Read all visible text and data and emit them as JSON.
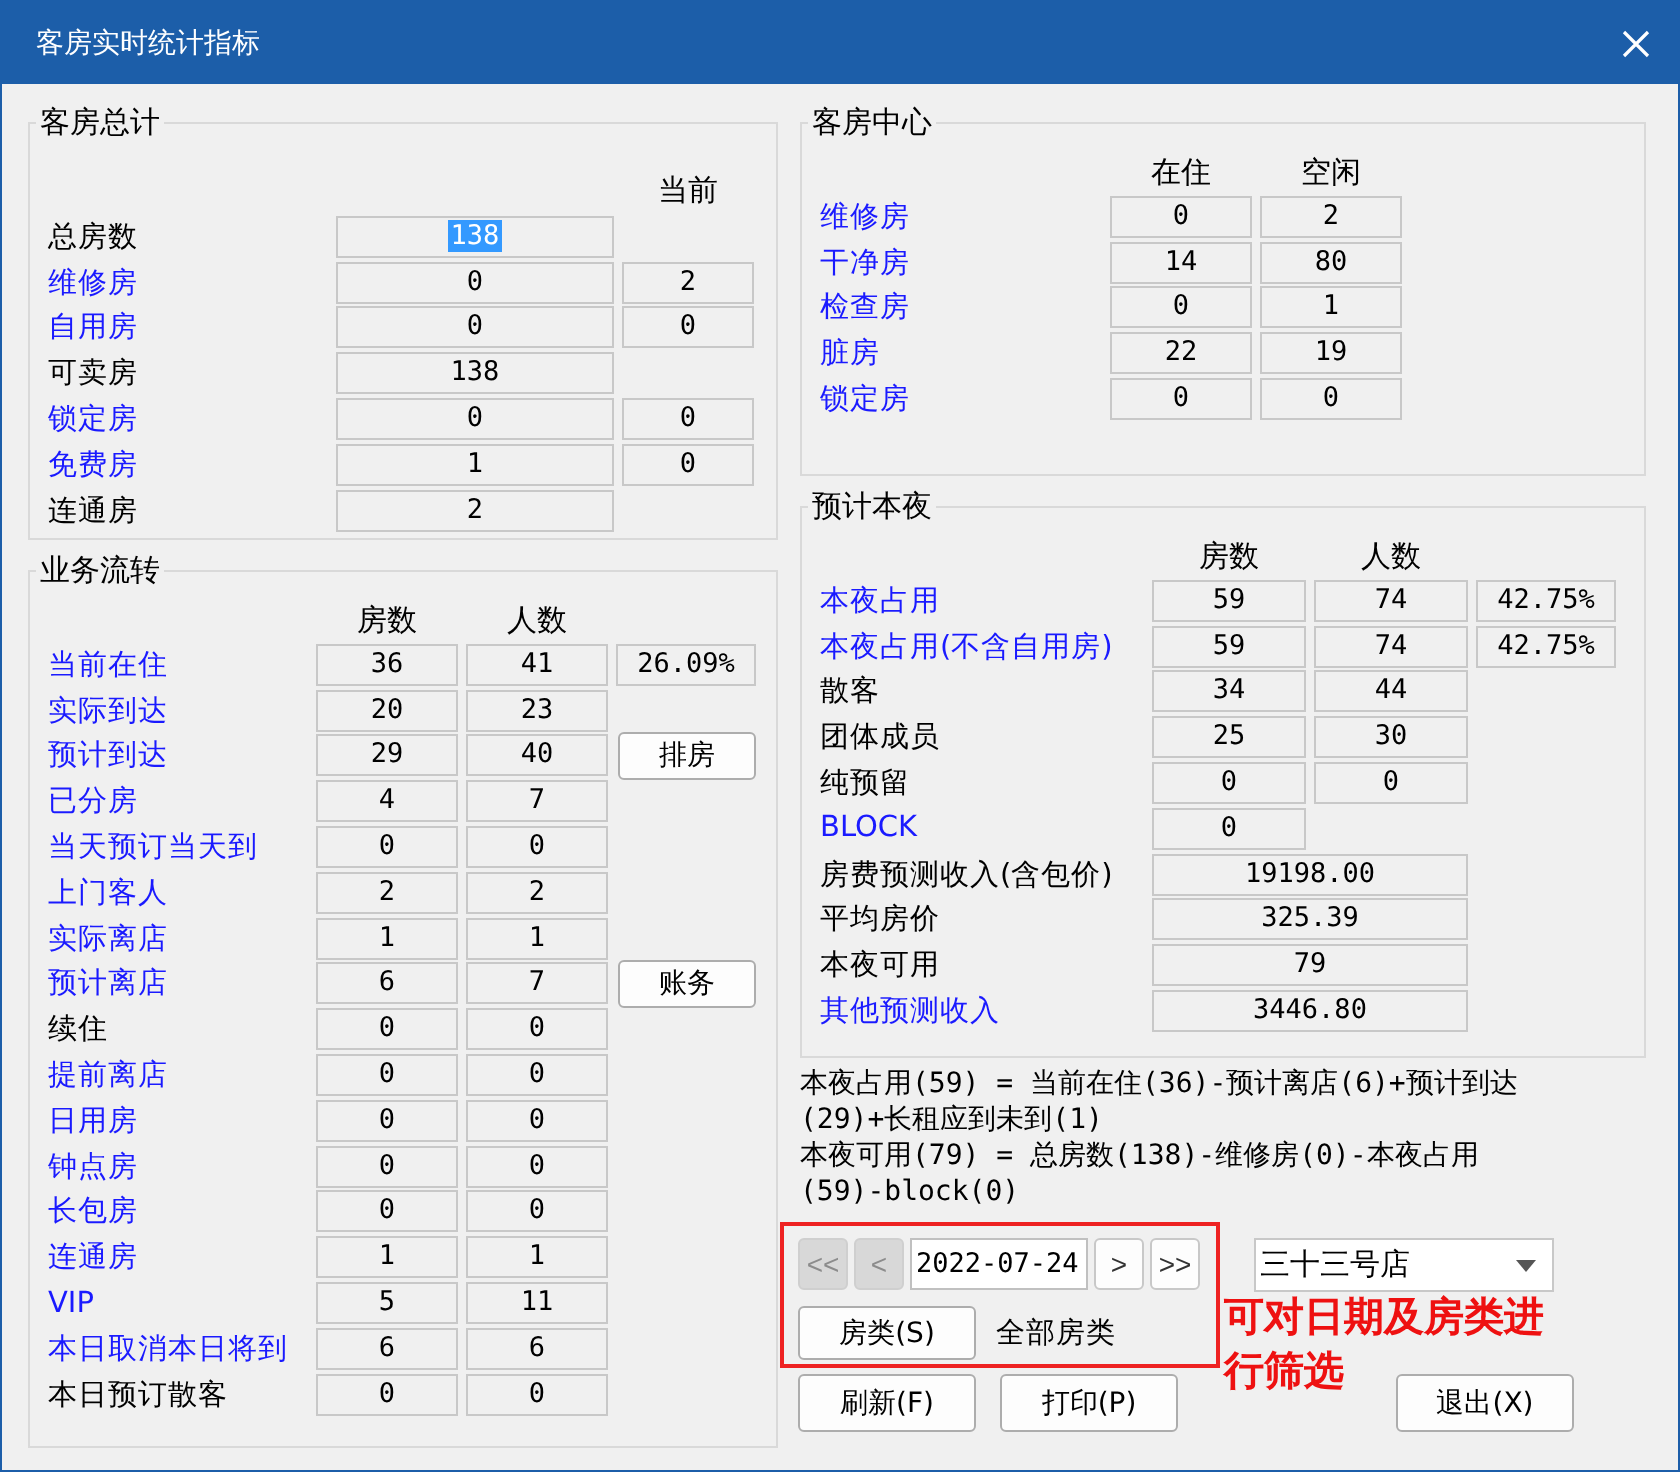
{
  "window": {
    "title": "客房实时统计指标"
  },
  "room_totals": {
    "title": "客房总计",
    "current_header": "当前",
    "rows": [
      {
        "label": "总房数",
        "link": false,
        "highlighted": true,
        "cells": [
          "138"
        ]
      },
      {
        "label": "维修房",
        "link": true,
        "highlighted": false,
        "cells": [
          "0",
          "2"
        ]
      },
      {
        "label": "自用房",
        "link": true,
        "highlighted": false,
        "cells": [
          "0",
          "0"
        ]
      },
      {
        "label": "可卖房",
        "link": false,
        "highlighted": false,
        "cells": [
          "138"
        ]
      },
      {
        "label": "锁定房",
        "link": true,
        "highlighted": false,
        "cells": [
          "0",
          "0"
        ]
      },
      {
        "label": "免费房",
        "link": true,
        "highlighted": false,
        "cells": [
          "1",
          "0"
        ]
      },
      {
        "label": "连通房",
        "link": false,
        "highlighted": false,
        "cells": [
          "2"
        ]
      }
    ]
  },
  "business_flow": {
    "title": "业务流转",
    "headers": [
      "房数",
      "人数"
    ],
    "rows": [
      {
        "label": "当前在住",
        "link": true,
        "cells": [
          "36",
          "41"
        ],
        "extra": {
          "kind": "value",
          "text": "26.09%"
        }
      },
      {
        "label": "实际到达",
        "link": true,
        "cells": [
          "20",
          "23"
        ]
      },
      {
        "label": "预计到达",
        "link": true,
        "cells": [
          "29",
          "40"
        ],
        "extra": {
          "kind": "button",
          "text": "排房"
        }
      },
      {
        "label": "已分房",
        "link": true,
        "cells": [
          "4",
          "7"
        ]
      },
      {
        "label": "当天预订当天到",
        "link": true,
        "cells": [
          "0",
          "0"
        ]
      },
      {
        "label": "上门客人",
        "link": true,
        "cells": [
          "2",
          "2"
        ]
      },
      {
        "label": "实际离店",
        "link": true,
        "cells": [
          "1",
          "1"
        ]
      },
      {
        "label": "预计离店",
        "link": true,
        "cells": [
          "6",
          "7"
        ],
        "extra": {
          "kind": "button",
          "text": "账务"
        }
      },
      {
        "label": "续住",
        "link": false,
        "cells": [
          "0",
          "0"
        ]
      },
      {
        "label": "提前离店",
        "link": true,
        "cells": [
          "0",
          "0"
        ]
      },
      {
        "label": "日用房",
        "link": true,
        "cells": [
          "0",
          "0"
        ]
      },
      {
        "label": "钟点房",
        "link": true,
        "cells": [
          "0",
          "0"
        ]
      },
      {
        "label": "长包房",
        "link": true,
        "cells": [
          "0",
          "0"
        ]
      },
      {
        "label": "连通房",
        "link": true,
        "cells": [
          "1",
          "1"
        ]
      },
      {
        "label": "VIP",
        "link": true,
        "cells": [
          "5",
          "11"
        ]
      },
      {
        "label": "本日取消本日将到",
        "link": true,
        "cells": [
          "6",
          "6"
        ]
      },
      {
        "label": "本日预订散客",
        "link": false,
        "cells": [
          "0",
          "0"
        ]
      }
    ]
  },
  "room_center": {
    "title": "客房中心",
    "headers": [
      "在住",
      "空闲"
    ],
    "rows": [
      {
        "label": "维修房",
        "link": true,
        "cells": [
          "0",
          "2"
        ]
      },
      {
        "label": "干净房",
        "link": true,
        "cells": [
          "14",
          "80"
        ]
      },
      {
        "label": "检查房",
        "link": true,
        "cells": [
          "0",
          "1"
        ]
      },
      {
        "label": "脏房",
        "link": true,
        "cells": [
          "22",
          "19"
        ]
      },
      {
        "label": "锁定房",
        "link": true,
        "cells": [
          "0",
          "0"
        ]
      }
    ]
  },
  "tonight": {
    "title": "预计本夜",
    "headers": [
      "房数",
      "人数"
    ],
    "rows": [
      {
        "label": "本夜占用",
        "link": true,
        "kind": "split",
        "cells": [
          "59",
          "74"
        ],
        "percent": "42.75%"
      },
      {
        "label": "本夜占用(不含自用房)",
        "link": true,
        "kind": "split",
        "cells": [
          "59",
          "74"
        ],
        "percent": "42.75%"
      },
      {
        "label": "散客",
        "link": false,
        "kind": "split",
        "cells": [
          "34",
          "44"
        ]
      },
      {
        "label": "团体成员",
        "link": false,
        "kind": "split",
        "cells": [
          "25",
          "30"
        ]
      },
      {
        "label": "纯预留",
        "link": false,
        "kind": "split",
        "cells": [
          "0",
          "0"
        ]
      },
      {
        "label": "BLOCK",
        "link": true,
        "kind": "split",
        "cells": [
          "0"
        ]
      },
      {
        "label": "房费预测收入(含包价)",
        "link": false,
        "kind": "wide",
        "cells": [
          "19198.00"
        ]
      },
      {
        "label": "平均房价",
        "link": false,
        "kind": "wide",
        "cells": [
          "325.39"
        ]
      },
      {
        "label": "本夜可用",
        "link": false,
        "kind": "wide",
        "cells": [
          "79"
        ]
      },
      {
        "label": "其他预测收入",
        "link": true,
        "kind": "wide",
        "cells": [
          "3446.80"
        ]
      }
    ]
  },
  "notes": [
    "本夜占用(59) = 当前在住(36)-预计离店(6)+预计到达(29)+长租应到未到(1)",
    "本夜可用(79) = 总房数(138)-维修房(0)-本夜占用(59)-block(0)"
  ],
  "filter": {
    "prev": [
      {
        "text": "<<",
        "disabled": true
      },
      {
        "text": "<",
        "disabled": true
      }
    ],
    "date": "2022-07-24",
    "next": [
      {
        "text": ">",
        "disabled": false
      },
      {
        "text": ">>",
        "disabled": false
      }
    ],
    "room_type_button": "房类(S)",
    "room_type_value": "全部房类"
  },
  "store": "三十三号店",
  "annotation": "可对日期及房类进行筛选",
  "buttons": [
    "刷新(F)",
    "打印(P)",
    "退出(X)"
  ]
}
